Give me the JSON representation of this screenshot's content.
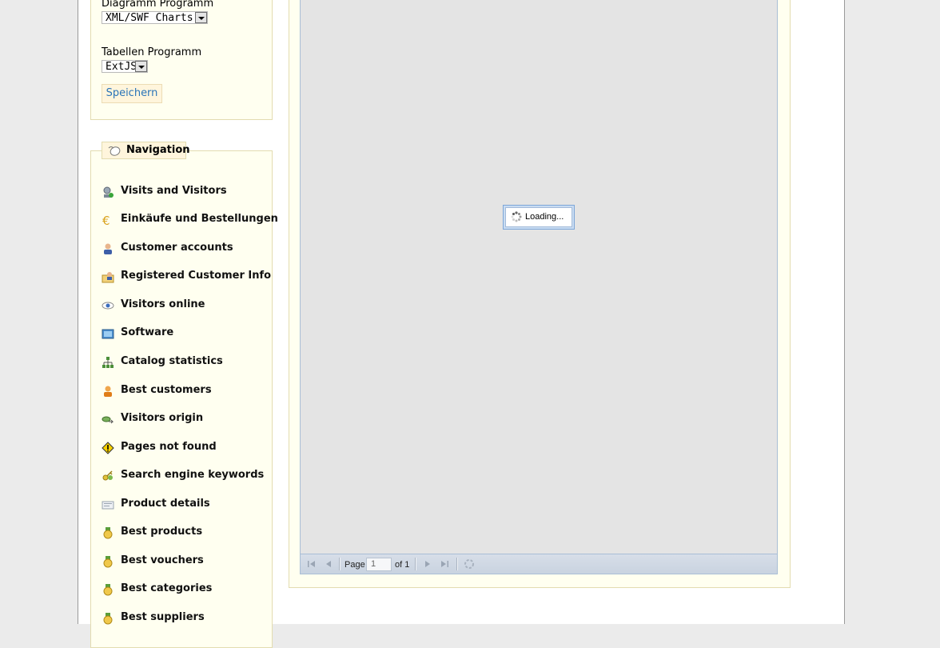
{
  "settings": {
    "chart_label": "Diagramm Programm",
    "chart_value": "XML/SWF Charts",
    "table_label": "Tabellen Programm",
    "table_value": "ExtJS",
    "save_label": "Speichern"
  },
  "navigation": {
    "title": "Navigation",
    "items": [
      {
        "label": "Visits and Visitors",
        "icon": "visitors-icon"
      },
      {
        "label": "Einkäufe und Bestellungen",
        "icon": "euro-icon"
      },
      {
        "label": "Customer accounts",
        "icon": "user-icon"
      },
      {
        "label": "Registered Customer Info",
        "icon": "user-card-icon"
      },
      {
        "label": "Visitors online",
        "icon": "eye-icon"
      },
      {
        "label": "Software",
        "icon": "monitor-icon"
      },
      {
        "label": "Catalog statistics",
        "icon": "sitemap-icon"
      },
      {
        "label": "Best customers",
        "icon": "customer-icon"
      },
      {
        "label": "Visitors origin",
        "icon": "origin-icon"
      },
      {
        "label": "Pages not found",
        "icon": "warning-icon"
      },
      {
        "label": "Search engine keywords",
        "icon": "key-icon"
      },
      {
        "label": "Product details",
        "icon": "product-icon"
      },
      {
        "label": "Best products",
        "icon": "medal-icon"
      },
      {
        "label": "Best vouchers",
        "icon": "medal-icon"
      },
      {
        "label": "Best categories",
        "icon": "medal-icon"
      },
      {
        "label": "Best suppliers",
        "icon": "medal-icon"
      }
    ]
  },
  "grid": {
    "loading_text": "Loading...",
    "pager": {
      "page_label": "Page",
      "page_value": "1",
      "of_label": "of 1"
    }
  },
  "colors": {
    "panel_bg": "#fffff0",
    "panel_border": "#e3dcb0",
    "link_blue": "#2a74b8",
    "grid_bg": "#e4e4e4"
  }
}
